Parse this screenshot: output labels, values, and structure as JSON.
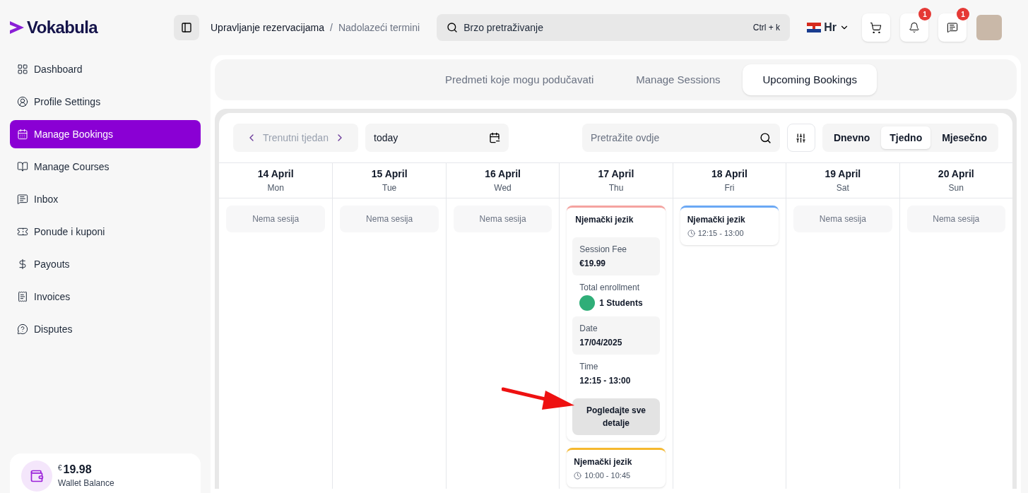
{
  "brand": {
    "name": "Vokabula"
  },
  "breadcrumb": {
    "items": [
      "Upravljanje rezervacijama",
      "Nadolazeći termini"
    ],
    "separator": "/"
  },
  "search": {
    "placeholder": "Brzo pretraživanje",
    "shortcut": "Ctrl + k"
  },
  "language": {
    "label": "Hr"
  },
  "notifications": {
    "badge": "1"
  },
  "messages": {
    "badge": "1"
  },
  "sidebar": {
    "items": [
      {
        "label": "Dashboard",
        "selected": false
      },
      {
        "label": "Profile Settings",
        "selected": false
      },
      {
        "label": "Manage Bookings",
        "selected": true
      },
      {
        "label": "Manage Courses",
        "selected": false
      },
      {
        "label": "Inbox",
        "selected": false
      },
      {
        "label": "Ponude i kuponi",
        "selected": false
      },
      {
        "label": "Payouts",
        "selected": false
      },
      {
        "label": "Invoices",
        "selected": false
      },
      {
        "label": "Disputes",
        "selected": false
      }
    ]
  },
  "wallet": {
    "currency": "€",
    "amount": "19.98",
    "label": "Wallet Balance"
  },
  "tabs": [
    {
      "label": "Predmeti koje mogu podučavati",
      "selected": false
    },
    {
      "label": "Manage Sessions",
      "selected": false
    },
    {
      "label": "Upcoming Bookings",
      "selected": true
    }
  ],
  "toolbar": {
    "period": "Trenutni tjedan",
    "date": "today",
    "search_placeholder": "Pretražite ovdje",
    "views": [
      {
        "label": "Dnevno",
        "selected": false
      },
      {
        "label": "Tjedno",
        "selected": true
      },
      {
        "label": "Mjesečno",
        "selected": false
      }
    ]
  },
  "days": [
    {
      "date": "14 April",
      "weekday": "Mon",
      "empty": "Nema sesija"
    },
    {
      "date": "15 April",
      "weekday": "Tue",
      "empty": "Nema sesija"
    },
    {
      "date": "16 April",
      "weekday": "Wed",
      "empty": "Nema sesija"
    },
    {
      "date": "17 April",
      "weekday": "Thu",
      "sessions": [
        {
          "kind": "expanded",
          "title": "Njemački jezik",
          "color": "#f5a3a0",
          "fee_label": "Session Fee",
          "fee": "€19.99",
          "enrollment_label": "Total enrollment",
          "enrollment": "1 Students",
          "date_label": "Date",
          "date": "17/04/2025",
          "time_label": "Time",
          "time": "12:15 - 13:00",
          "button": "Pogledajte sve detalje"
        },
        {
          "kind": "compact",
          "title": "Njemački jezik",
          "color": "#f5b82e",
          "time": "10:00 - 10:45"
        }
      ]
    },
    {
      "date": "18 April",
      "weekday": "Fri",
      "sessions": [
        {
          "kind": "compact",
          "title": "Njemački jezik",
          "color": "#6aa8f5",
          "time": "12:15 - 13:00"
        }
      ]
    },
    {
      "date": "19 April",
      "weekday": "Sat",
      "empty": "Nema sesija"
    },
    {
      "date": "20 April",
      "weekday": "Sun",
      "empty": "Nema sesija"
    }
  ]
}
